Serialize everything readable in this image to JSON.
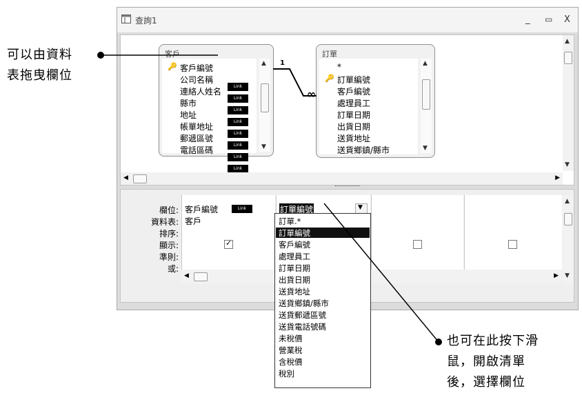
{
  "window": {
    "title": "查詢1",
    "minimize": "_",
    "maximize": "▭",
    "close": "X"
  },
  "tables": [
    {
      "title": "客戶",
      "fields": [
        "客戶編號",
        "公司名稱",
        "連絡人姓名",
        "縣市",
        "地址",
        "帳單地址",
        "郵遞區號",
        "電話區碼"
      ]
    },
    {
      "title": "訂單",
      "fields": [
        "*",
        "訂單編號",
        "客戶編號",
        "處理員工",
        "訂單日期",
        "出貨日期",
        "送貨地址",
        "送貨鄉鎮/縣市"
      ]
    }
  ],
  "relation": {
    "one": "1",
    "many": "∞"
  },
  "field_tag": "Link",
  "grid": {
    "row_labels": [
      "欄位:",
      "資料表:",
      "排序:",
      "顯示:",
      "準則:",
      "或:"
    ],
    "col1": {
      "field": "客戶編號",
      "table": "客戶"
    },
    "col2": {
      "field": "訂單編號"
    }
  },
  "dropdown": {
    "selected_index": 1,
    "items": [
      "訂單.*",
      "訂單編號",
      "客戶編號",
      "處理員工",
      "訂單日期",
      "出貨日期",
      "送貨地址",
      "送貨鄉鎮/縣市",
      "送貨郵遞區號",
      "送貨電話號碼",
      "未稅價",
      "營業稅",
      "含稅價",
      "稅別"
    ]
  },
  "callouts": {
    "left": [
      "可以由資料",
      "表拖曳欄位"
    ],
    "right": [
      "也可在此按下滑",
      "鼠，開啟清單",
      "後，選擇欄位"
    ]
  }
}
